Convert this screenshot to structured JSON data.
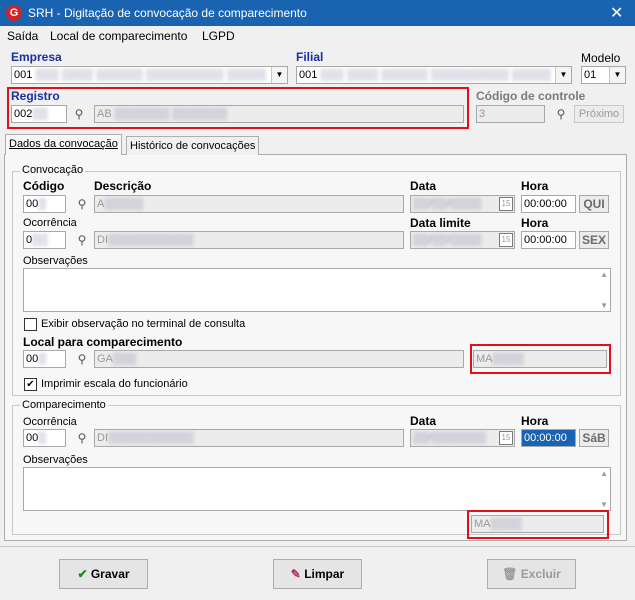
{
  "window": {
    "title": "SRH - Digitação de convocação de comparecimento",
    "logo": "G"
  },
  "menu": [
    "Saída",
    "Local de comparecimento",
    "LGPD"
  ],
  "header": {
    "empresa_label": "Empresa",
    "empresa_value": "001",
    "filial_label": "Filial",
    "filial_value": "001",
    "modelo_label": "Modelo",
    "modelo_value": "01",
    "registro_label": "Registro",
    "registro_value": "002",
    "registro_desc": "AB",
    "codigo_controle_label": "Código de controle",
    "codigo_controle_value": "3",
    "proximo_label": "Próximo"
  },
  "tabs": [
    "Dados da convocação",
    "Histórico de convocações"
  ],
  "convocacao": {
    "group_title": "Convocação",
    "codigo_label": "Código",
    "codigo_value": "00",
    "descricao_label": "Descrição",
    "descricao_value": "A",
    "data_label": "Data",
    "hora_label": "Hora",
    "hora_value": "00:00:00",
    "dia": "QUI",
    "ocorrencia_label": "Ocorrência",
    "ocorrencia_value": "0",
    "ocorrencia_desc": "DI",
    "data_limite_label": "Data limite",
    "hora2_label": "Hora",
    "hora2_value": "00:00:00",
    "dia2": "SEX",
    "observacoes_label": "Observações",
    "exibir_label": "Exibir observação no terminal de consulta",
    "local_label": "Local para comparecimento",
    "local_value": "00",
    "local_desc": "GA",
    "local_extra": "MA",
    "imprimir_label": "Imprimir escala do funcionário"
  },
  "comparecimento": {
    "group_title": "Comparecimento",
    "ocorrencia_label": "Ocorrência",
    "ocorrencia_value": "00",
    "ocorrencia_desc": "DI",
    "data_label": "Data",
    "hora_label": "Hora",
    "hora_value": "00:00:00",
    "dia": "SáB",
    "observacoes_label": "Observações",
    "extra": "MA"
  },
  "buttons": {
    "gravar": "Gravar",
    "limpar": "Limpar",
    "excluir": "Excluir"
  },
  "colors": {
    "titlebar": "#1a63b0",
    "highlight_red": "#e0101c",
    "label_blue": "#1a2fa0"
  }
}
